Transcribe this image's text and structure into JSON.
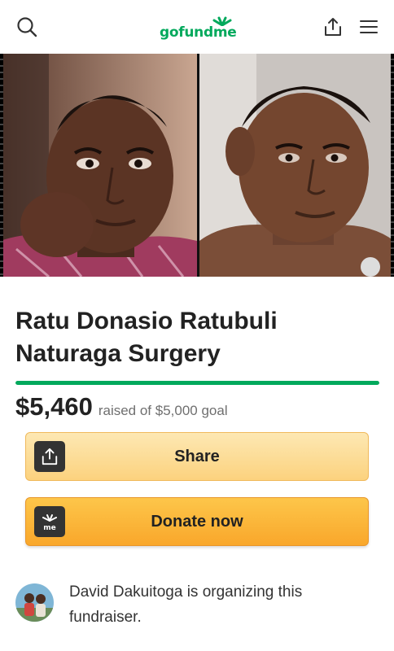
{
  "header": {
    "logo_text": "gofundme",
    "icons": [
      "search-icon",
      "share-icon",
      "menu-icon"
    ]
  },
  "hero": {
    "photos": [
      "campaign-photo-left",
      "campaign-photo-right"
    ]
  },
  "campaign": {
    "title": "Ratu Donasio Ratubuli Naturaga Surgery",
    "amount_raised": "$5,460",
    "goal_text": "raised of $5,000 goal",
    "progress_fraction": 1.0
  },
  "actions": {
    "share_label": "Share",
    "donate_label": "Donate now",
    "donate_icon_text": "me"
  },
  "organizer": {
    "text": "David Dakuitoga is organizing this fundraiser."
  },
  "colors": {
    "brand_green": "#02a95c",
    "share_button": "#fcd27e",
    "donate_button": "#f9a72b"
  }
}
